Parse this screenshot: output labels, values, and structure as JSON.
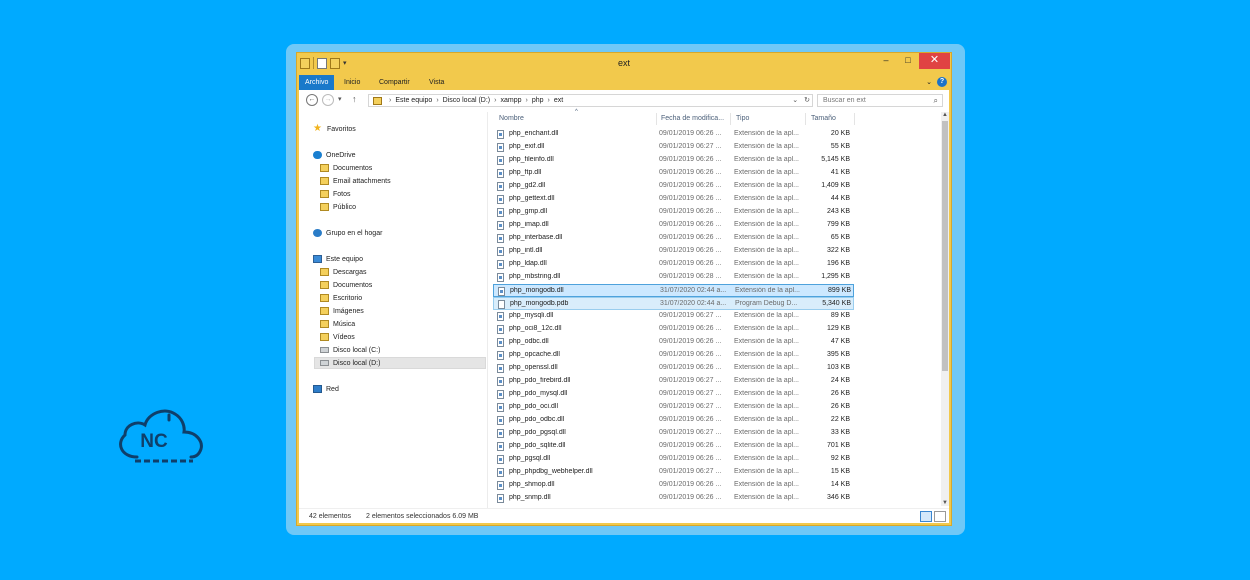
{
  "logo": {
    "text": "NC"
  },
  "window": {
    "title": "ext",
    "controls": {
      "minimize": "–",
      "maximize": "□",
      "close": "✕"
    },
    "ribbon_tabs": [
      "Archivo",
      "Inicio",
      "Compartir",
      "Vista"
    ]
  },
  "address_bar": {
    "crumbs": [
      "Este equipo",
      "Disco local (D:)",
      "xampp",
      "php",
      "ext"
    ],
    "search_placeholder": "Buscar en ext"
  },
  "nav": [
    {
      "label": "Favoritos",
      "icon": "star-icon"
    },
    {
      "label": "OneDrive",
      "icon": "onedrive-icon"
    },
    {
      "label": "Documentos",
      "icon": "folder-icon"
    },
    {
      "label": "Email attachments",
      "icon": "folder-icon"
    },
    {
      "label": "Fotos",
      "icon": "folder-icon"
    },
    {
      "label": "Público",
      "icon": "folder-icon"
    },
    {
      "label": "Grupo en el hogar",
      "icon": "homegroup-icon"
    },
    {
      "label": "Este equipo",
      "icon": "computer-icon"
    },
    {
      "label": "Descargas",
      "icon": "folder-icon"
    },
    {
      "label": "Documentos",
      "icon": "folder-icon"
    },
    {
      "label": "Escritorio",
      "icon": "folder-icon"
    },
    {
      "label": "Imágenes",
      "icon": "folder-icon"
    },
    {
      "label": "Música",
      "icon": "folder-icon"
    },
    {
      "label": "Vídeos",
      "icon": "folder-icon"
    },
    {
      "label": "Disco local (C:)",
      "icon": "drive-icon"
    },
    {
      "label": "Disco local (D:)",
      "icon": "drive-icon",
      "selected": true
    },
    {
      "label": "Red",
      "icon": "network-icon"
    }
  ],
  "columns": {
    "name": "Nombre",
    "date": "Fecha de modifica...",
    "type": "Tipo",
    "size": "Tamaño"
  },
  "files": [
    {
      "name": "php_enchant.dll",
      "date": "09/01/2019 06:26 ...",
      "type": "Extensión de la apl...",
      "size": "20 KB"
    },
    {
      "name": "php_exif.dll",
      "date": "09/01/2019 06:27 ...",
      "type": "Extensión de la apl...",
      "size": "55 KB"
    },
    {
      "name": "php_fileinfo.dll",
      "date": "09/01/2019 06:26 ...",
      "type": "Extensión de la apl...",
      "size": "5,145 KB"
    },
    {
      "name": "php_ftp.dll",
      "date": "09/01/2019 06:26 ...",
      "type": "Extensión de la apl...",
      "size": "41 KB"
    },
    {
      "name": "php_gd2.dll",
      "date": "09/01/2019 06:26 ...",
      "type": "Extensión de la apl...",
      "size": "1,409 KB"
    },
    {
      "name": "php_gettext.dll",
      "date": "09/01/2019 06:26 ...",
      "type": "Extensión de la apl...",
      "size": "44 KB"
    },
    {
      "name": "php_gmp.dll",
      "date": "09/01/2019 06:26 ...",
      "type": "Extensión de la apl...",
      "size": "243 KB"
    },
    {
      "name": "php_imap.dll",
      "date": "09/01/2019 06:26 ...",
      "type": "Extensión de la apl...",
      "size": "799 KB"
    },
    {
      "name": "php_interbase.dll",
      "date": "09/01/2019 06:26 ...",
      "type": "Extensión de la apl...",
      "size": "65 KB"
    },
    {
      "name": "php_intl.dll",
      "date": "09/01/2019 06:26 ...",
      "type": "Extensión de la apl...",
      "size": "322 KB"
    },
    {
      "name": "php_ldap.dll",
      "date": "09/01/2019 06:26 ...",
      "type": "Extensión de la apl...",
      "size": "196 KB"
    },
    {
      "name": "php_mbstring.dll",
      "date": "09/01/2019 06:28 ...",
      "type": "Extensión de la apl...",
      "size": "1,295 KB"
    },
    {
      "name": "php_mongodb.dll",
      "date": "31/07/2020 02:44 a...",
      "type": "Extensión de la apl...",
      "size": "899 KB",
      "state": "sel"
    },
    {
      "name": "php_mongodb.pdb",
      "date": "31/07/2020 02:44 a...",
      "type": "Program Debug D...",
      "size": "5,340 KB",
      "state": "sel2"
    },
    {
      "name": "php_mysqli.dll",
      "date": "09/01/2019 06:27 ...",
      "type": "Extensión de la apl...",
      "size": "89 KB"
    },
    {
      "name": "php_oci8_12c.dll",
      "date": "09/01/2019 06:26 ...",
      "type": "Extensión de la apl...",
      "size": "129 KB"
    },
    {
      "name": "php_odbc.dll",
      "date": "09/01/2019 06:26 ...",
      "type": "Extensión de la apl...",
      "size": "47 KB"
    },
    {
      "name": "php_opcache.dll",
      "date": "09/01/2019 06:26 ...",
      "type": "Extensión de la apl...",
      "size": "395 KB"
    },
    {
      "name": "php_openssl.dll",
      "date": "09/01/2019 06:26 ...",
      "type": "Extensión de la apl...",
      "size": "103 KB"
    },
    {
      "name": "php_pdo_firebird.dll",
      "date": "09/01/2019 06:27 ...",
      "type": "Extensión de la apl...",
      "size": "24 KB"
    },
    {
      "name": "php_pdo_mysql.dll",
      "date": "09/01/2019 06:27 ...",
      "type": "Extensión de la apl...",
      "size": "26 KB"
    },
    {
      "name": "php_pdo_oci.dll",
      "date": "09/01/2019 06:27 ...",
      "type": "Extensión de la apl...",
      "size": "26 KB"
    },
    {
      "name": "php_pdo_odbc.dll",
      "date": "09/01/2019 06:26 ...",
      "type": "Extensión de la apl...",
      "size": "22 KB"
    },
    {
      "name": "php_pdo_pgsql.dll",
      "date": "09/01/2019 06:27 ...",
      "type": "Extensión de la apl...",
      "size": "33 KB"
    },
    {
      "name": "php_pdo_sqlite.dll",
      "date": "09/01/2019 06:26 ...",
      "type": "Extensión de la apl...",
      "size": "701 KB"
    },
    {
      "name": "php_pgsql.dll",
      "date": "09/01/2019 06:26 ...",
      "type": "Extensión de la apl...",
      "size": "92 KB"
    },
    {
      "name": "php_phpdbg_webhelper.dll",
      "date": "09/01/2019 06:27 ...",
      "type": "Extensión de la apl...",
      "size": "15 KB"
    },
    {
      "name": "php_shmop.dll",
      "date": "09/01/2019 06:26 ...",
      "type": "Extensión de la apl...",
      "size": "14 KB"
    },
    {
      "name": "php_snmp.dll",
      "date": "09/01/2019 06:26 ...",
      "type": "Extensión de la apl...",
      "size": "346 KB"
    }
  ],
  "status": {
    "count": "42 elementos",
    "selection": "2 elementos seleccionados  6.09 MB"
  }
}
